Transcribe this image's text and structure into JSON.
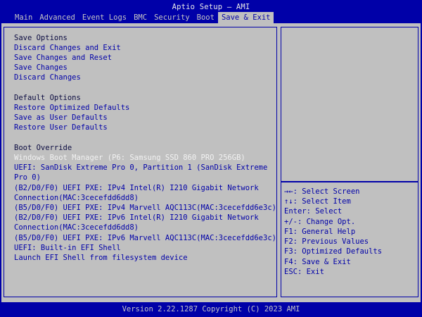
{
  "title": "Aptio Setup – AMI",
  "menu": [
    "Main",
    "Advanced",
    "Event Logs",
    "BMC",
    "Security",
    "Boot",
    "Save & Exit"
  ],
  "save_options": {
    "header": "Save Options",
    "items": [
      "Discard Changes and Exit",
      "Save Changes and Reset",
      "Save Changes",
      "Discard Changes"
    ]
  },
  "default_options": {
    "header": "Default Options",
    "items": [
      "Restore Optimized Defaults",
      "Save as User Defaults",
      "Restore User Defaults"
    ]
  },
  "boot_override": {
    "header": "Boot Override",
    "lines": [
      "Windows Boot Manager (P6: Samsung SSD 860 PRO 256GB)",
      "UEFI: SanDisk Extreme Pro 0, Partition 1 (SanDisk Extreme",
      "Pro 0)",
      "(B2/D0/F0) UEFI PXE: IPv4 Intel(R) I210 Gigabit  Network",
      "Connection(MAC:3cecefdd6dd8)",
      "(B5/D0/F0) UEFI PXE: IPv4 Marvell AQC113C(MAC:3cecefdd6e3c)",
      "(B2/D0/F0) UEFI PXE: IPv6 Intel(R) I210 Gigabit  Network",
      "Connection(MAC:3cecefdd6dd8)",
      "(B5/D0/F0) UEFI PXE: IPv6 Marvell AQC113C(MAC:3cecefdd6e3c)",
      "UEFI: Built-in EFI Shell",
      "Launch EFI Shell from filesystem device"
    ]
  },
  "help": [
    "→←: Select Screen",
    "↑↓: Select Item",
    "Enter: Select",
    "+/-: Change Opt.",
    "F1: General Help",
    "F2: Previous Values",
    "F3: Optimized Defaults",
    "F4: Save & Exit",
    "ESC: Exit"
  ],
  "footer": "Version 2.22.1287 Copyright (C) 2023 AMI",
  "colors": {
    "frame_bg": "#0000A8",
    "panel_bg": "#C0C0C0",
    "selected_text": "#F2F2F2"
  }
}
